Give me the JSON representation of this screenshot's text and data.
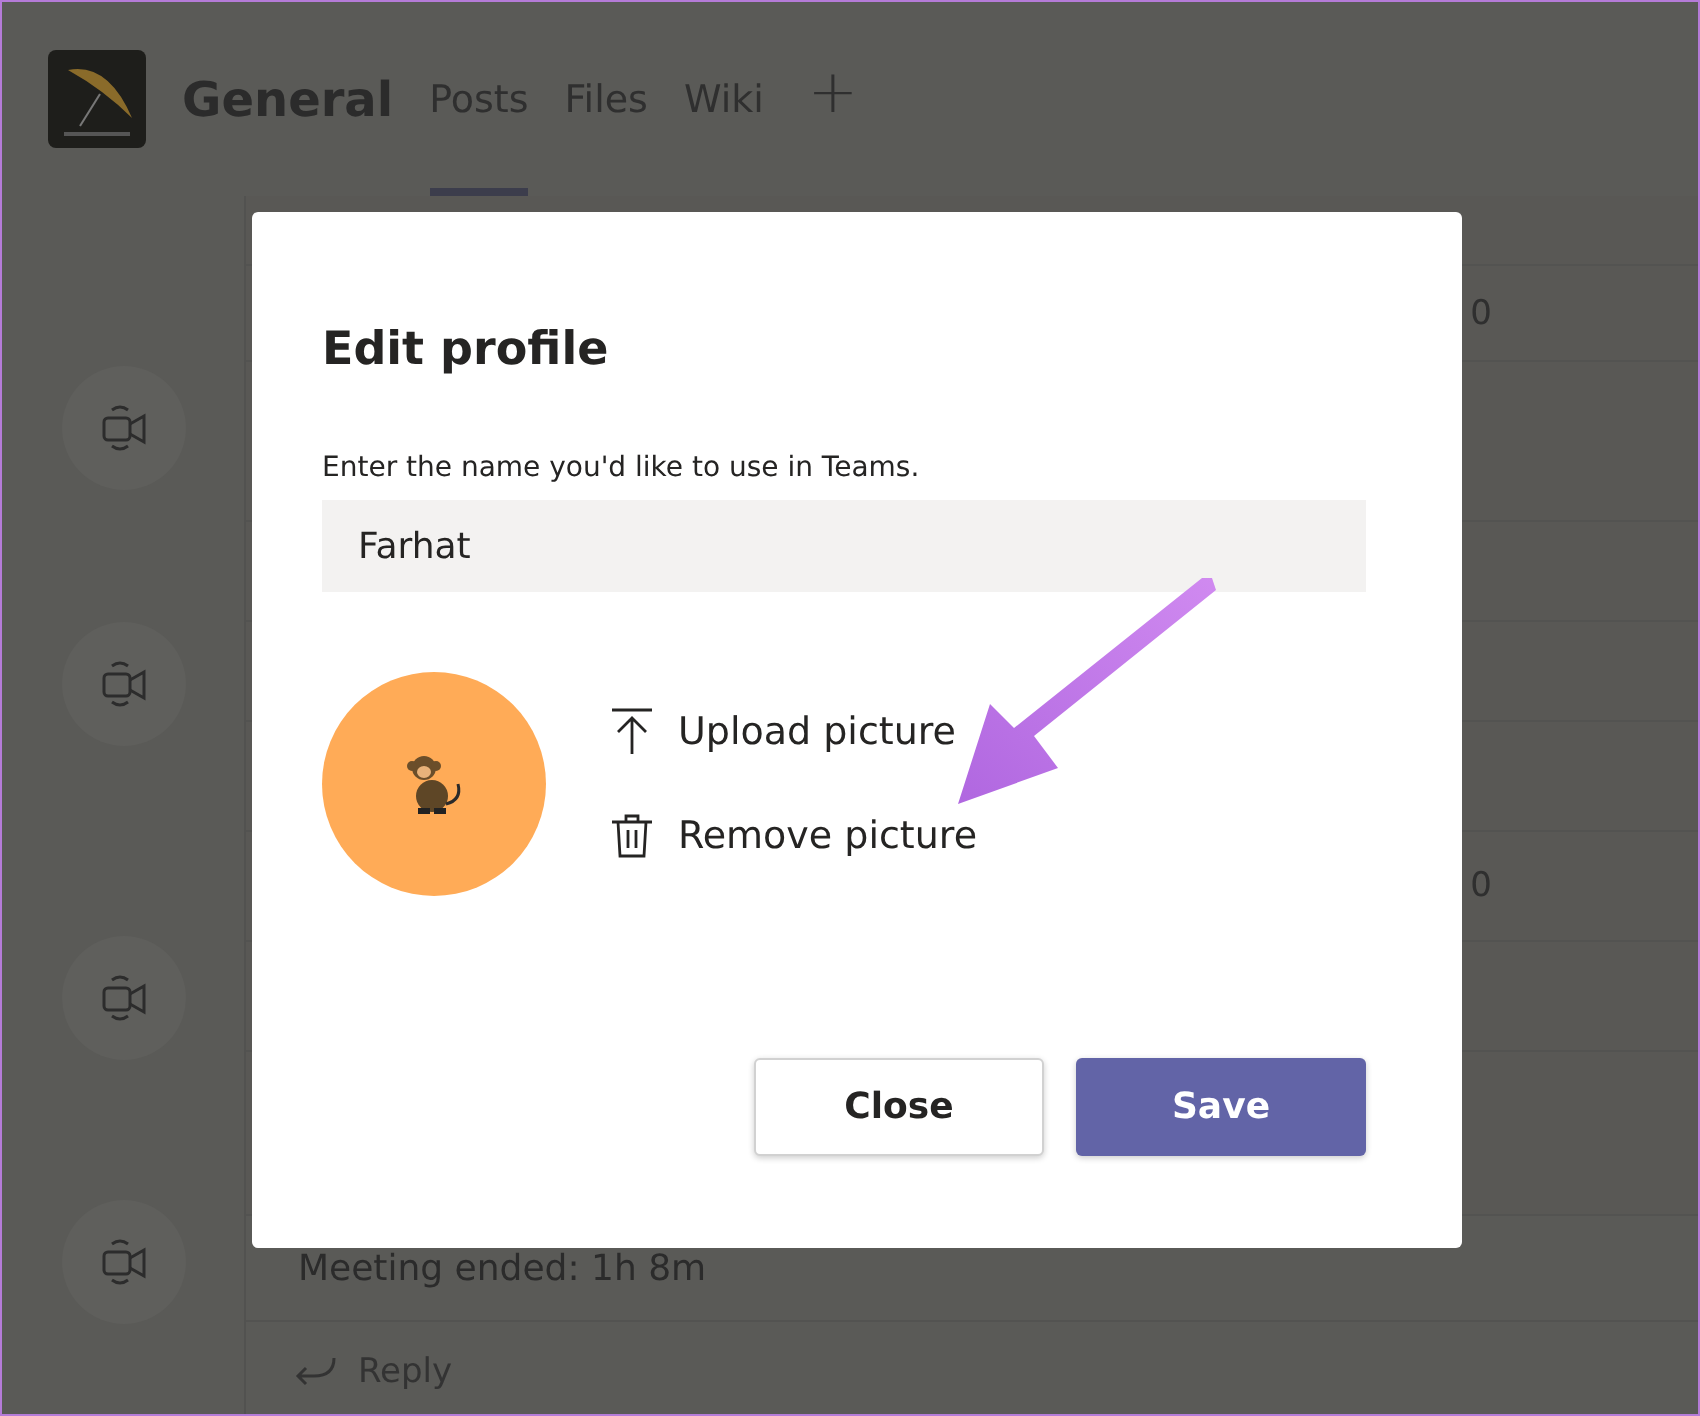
{
  "header": {
    "channel": "General",
    "tabs": [
      {
        "label": "Posts",
        "selected": true
      },
      {
        "label": "Files",
        "selected": false
      },
      {
        "label": "Wiki",
        "selected": false
      }
    ],
    "add": "+"
  },
  "posts": [
    {
      "kind": "meeting",
      "timestamp": "0"
    },
    {
      "kind": "meeting"
    },
    {
      "kind": "meeting",
      "timestamp": "0"
    },
    {
      "kind": "meeting",
      "message": "Meeting ended: 1h 8m",
      "reply": "Reply"
    }
  ],
  "dialog": {
    "title": "Edit profile",
    "label": "Enter the name you'd like to use in Teams.",
    "name": "Farhat",
    "actions": [
      {
        "kind": "upload",
        "label": "Upload picture"
      },
      {
        "kind": "remove",
        "label": "Remove picture"
      }
    ],
    "buttons": [
      {
        "label": "Close",
        "primary": false
      },
      {
        "label": "Save",
        "primary": true
      }
    ]
  }
}
